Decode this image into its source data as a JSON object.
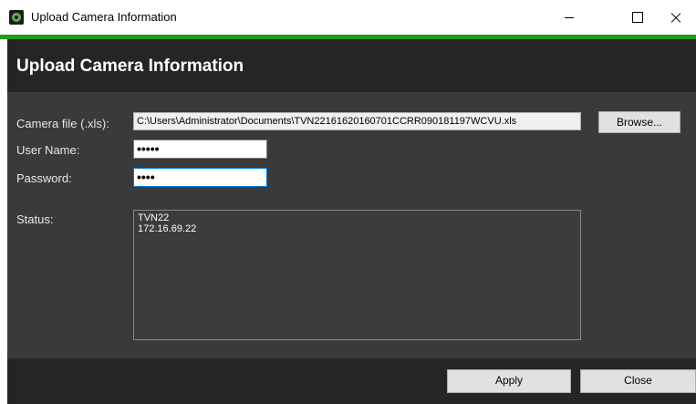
{
  "window": {
    "title": "Upload Camera Information",
    "icon": "camera-app-icon"
  },
  "header": {
    "title": "Upload Camera Information"
  },
  "form": {
    "camera_file_label": "Camera file (.xls):",
    "camera_file_value": "C:\\Users\\Administrator\\Documents\\TVN22161620160701CCRR090181197WCVU.xls",
    "browse_label": "Browse...",
    "username_label": "User Name:",
    "username_mask": "•••••",
    "password_label": "Password:",
    "password_mask": "••••",
    "status_label": "Status:",
    "status_lines": [
      "TVN22",
      "172.16.69.22"
    ]
  },
  "footer": {
    "apply_label": "Apply",
    "close_label": "Close"
  },
  "colors": {
    "accent": "#1f9b1f",
    "header_bg": "#252525",
    "content_bg": "#3a3a3a"
  }
}
